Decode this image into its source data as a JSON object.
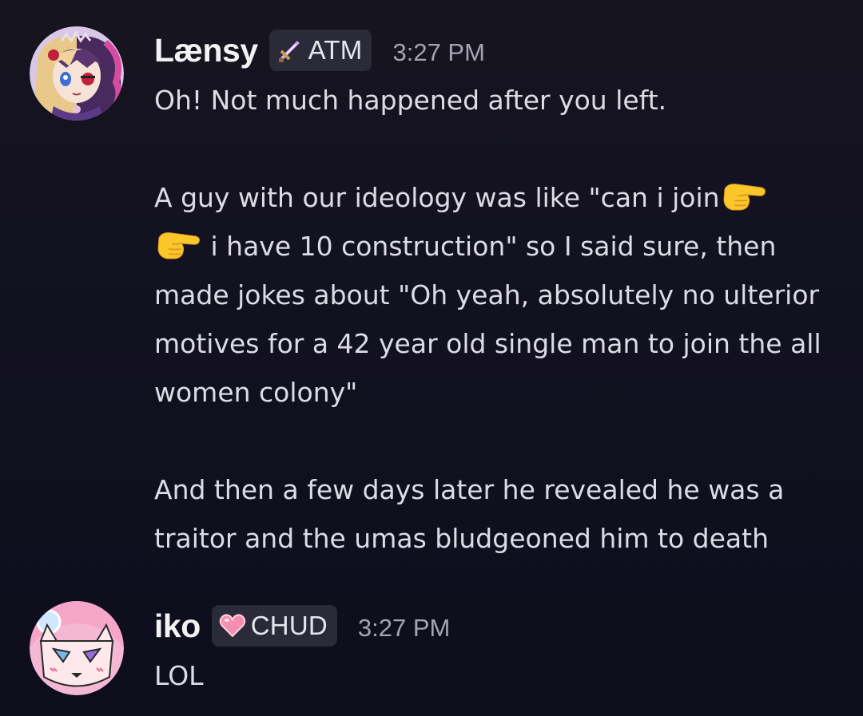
{
  "messages": [
    {
      "username": "Lænsy",
      "tag": {
        "label": "ATM",
        "icon": "sword-icon"
      },
      "timestamp": "3:27 PM",
      "avatar": "anime-girl-avatar",
      "paragraphs": {
        "p1": "Oh! Not much happened after you left.",
        "p2_a": "A guy with our ideology was like \"can i join",
        "p2_b": "i have 10 construction\" so I said sure, then made jokes about \"Oh yeah, absolutely no ulterior motives for a 42 year old single man to join the all women colony\"",
        "p3": "And then a few days later he revealed he was a traitor and the umas bludgeoned him to death"
      },
      "emojis": [
        "pointing-right-icon",
        "pointing-right-icon"
      ]
    },
    {
      "username": "iko",
      "tag": {
        "label": "CHUD",
        "icon": "pink-heart-icon"
      },
      "timestamp": "3:27 PM",
      "avatar": "pixel-cat-avatar",
      "paragraphs": {
        "p1": "LOL"
      }
    }
  ],
  "colors": {
    "background": "#121120",
    "username": "#f2f2f5",
    "text": "#dcdce4",
    "timestamp": "#a4a4b2",
    "tag_bg": "#2a2a38",
    "heart": "#f48fb1"
  }
}
